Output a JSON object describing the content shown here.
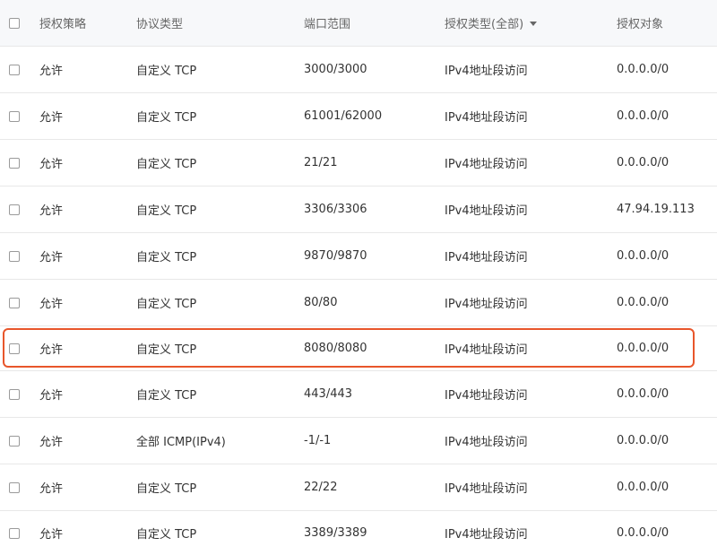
{
  "header": {
    "policy": "授权策略",
    "protocol": "协议类型",
    "port": "端口范围",
    "auth_type": "授权类型(全部)",
    "object": "授权对象"
  },
  "rows": [
    {
      "policy": "允许",
      "protocol": "自定义 TCP",
      "port": "3000/3000",
      "auth_type": "IPv4地址段访问",
      "object": "0.0.0.0/0"
    },
    {
      "policy": "允许",
      "protocol": "自定义 TCP",
      "port": "61001/62000",
      "auth_type": "IPv4地址段访问",
      "object": "0.0.0.0/0"
    },
    {
      "policy": "允许",
      "protocol": "自定义 TCP",
      "port": "21/21",
      "auth_type": "IPv4地址段访问",
      "object": "0.0.0.0/0"
    },
    {
      "policy": "允许",
      "protocol": "自定义 TCP",
      "port": "3306/3306",
      "auth_type": "IPv4地址段访问",
      "object": "47.94.19.113"
    },
    {
      "policy": "允许",
      "protocol": "自定义 TCP",
      "port": "9870/9870",
      "auth_type": "IPv4地址段访问",
      "object": "0.0.0.0/0"
    },
    {
      "policy": "允许",
      "protocol": "自定义 TCP",
      "port": "80/80",
      "auth_type": "IPv4地址段访问",
      "object": "0.0.0.0/0"
    },
    {
      "policy": "允许",
      "protocol": "自定义 TCP",
      "port": "8080/8080",
      "auth_type": "IPv4地址段访问",
      "object": "0.0.0.0/0"
    },
    {
      "policy": "允许",
      "protocol": "自定义 TCP",
      "port": "443/443",
      "auth_type": "IPv4地址段访问",
      "object": "0.0.0.0/0"
    },
    {
      "policy": "允许",
      "protocol": "全部 ICMP(IPv4)",
      "port": "-1/-1",
      "auth_type": "IPv4地址段访问",
      "object": "0.0.0.0/0"
    },
    {
      "policy": "允许",
      "protocol": "自定义 TCP",
      "port": "22/22",
      "auth_type": "IPv4地址段访问",
      "object": "0.0.0.0/0"
    },
    {
      "policy": "允许",
      "protocol": "自定义 TCP",
      "port": "3389/3389",
      "auth_type": "IPv4地址段访问",
      "object": "0.0.0.0/0"
    }
  ],
  "highlight_color": "#e8562b"
}
